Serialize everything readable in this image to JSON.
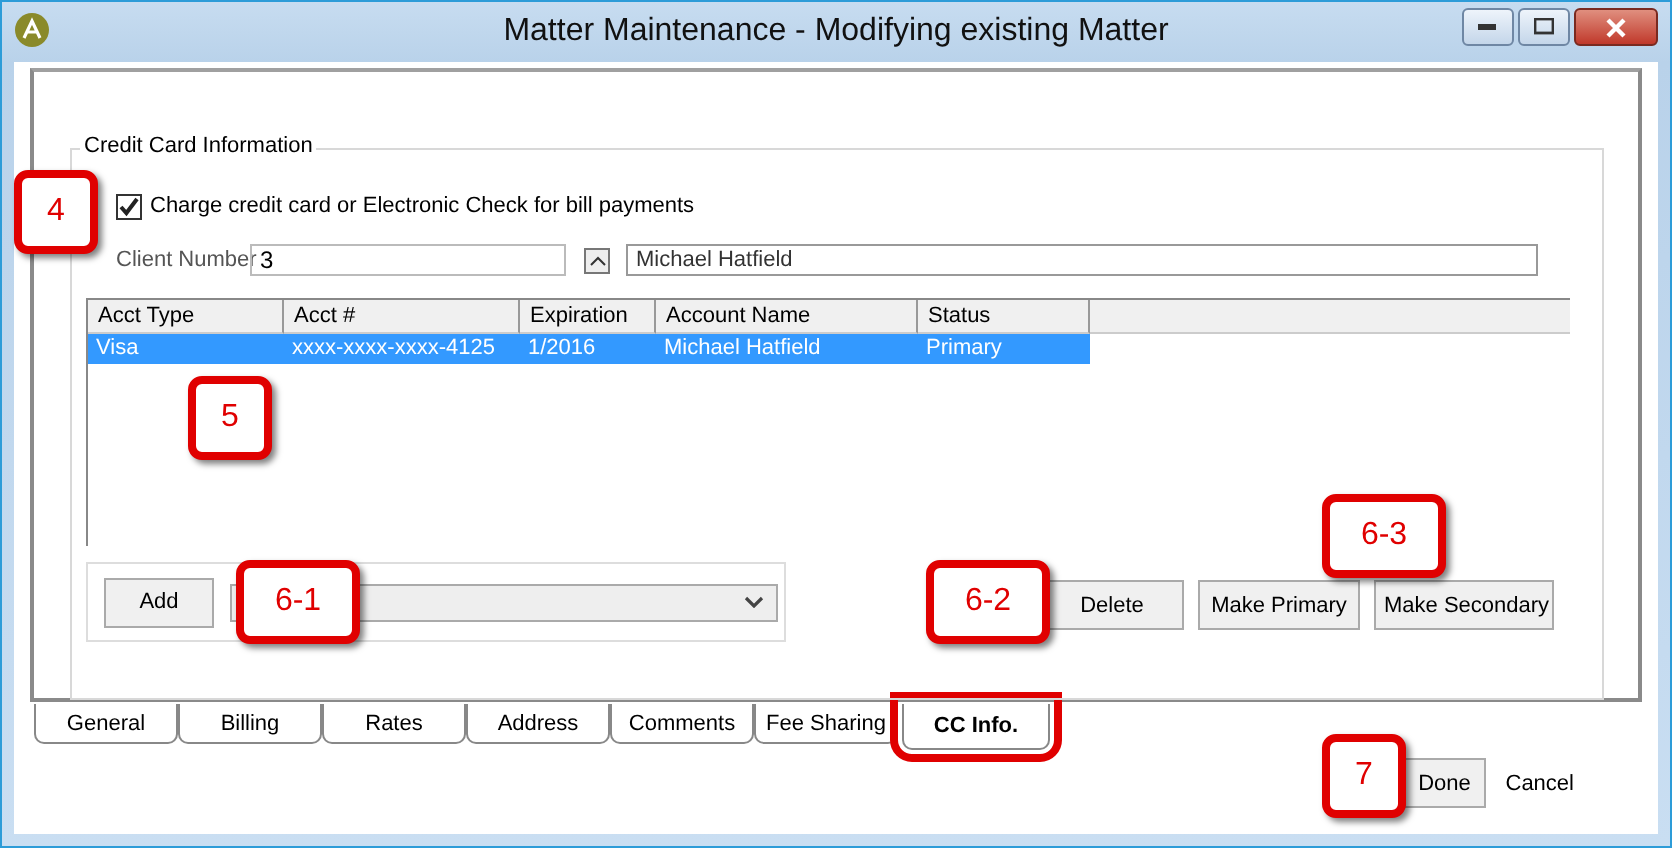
{
  "window": {
    "title": "Matter Maintenance - Modifying existing Matter"
  },
  "group": {
    "title": "Credit Card Information"
  },
  "charge_checkbox": {
    "label": "Charge credit card or Electronic Check for bill payments",
    "checked": true
  },
  "client": {
    "label": "Client Number",
    "value": "3",
    "name": "Michael Hatfield"
  },
  "table": {
    "columns": [
      "Acct Type",
      "Acct #",
      "Expiration",
      "Account Name",
      "Status"
    ],
    "rows": [
      {
        "cells": [
          "Visa",
          "xxxx-xxxx-xxxx-4125",
          "1/2016",
          "Michael Hatfield",
          "Primary"
        ],
        "selected": true
      }
    ]
  },
  "add_button": "Add",
  "actions": [
    "Delete",
    "Make Primary",
    "Make Secondary"
  ],
  "tabs": [
    {
      "label": "General",
      "selected": false,
      "highlighted": false
    },
    {
      "label": "Billing",
      "selected": false,
      "highlighted": false
    },
    {
      "label": "Rates",
      "selected": false,
      "highlighted": false
    },
    {
      "label": "Address",
      "selected": false,
      "highlighted": false
    },
    {
      "label": "Comments",
      "selected": false,
      "highlighted": false
    },
    {
      "label": "Fee Sharing",
      "selected": false,
      "highlighted": false
    },
    {
      "label": "CC Info.",
      "selected": true,
      "highlighted": true
    }
  ],
  "footer": {
    "done": "Done",
    "cancel": "Cancel"
  },
  "callouts": [
    "4",
    "5",
    "6-1",
    "6-2",
    "6-3",
    "7"
  ]
}
